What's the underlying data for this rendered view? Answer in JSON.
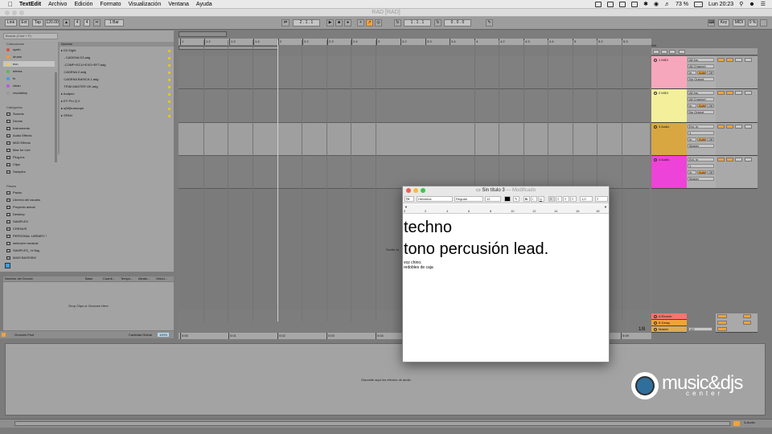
{
  "menubar": {
    "app": "TextEdit",
    "items": [
      "Archivo",
      "Edición",
      "Formato",
      "Visualización",
      "Ventana",
      "Ayuda"
    ],
    "battery": "73 %",
    "clock": "Lun 20:23"
  },
  "live_window": {
    "title": "RAD [RAD]"
  },
  "transport": {
    "link": "Link",
    "ext": "Ext",
    "tap": "Tap",
    "tempo": "120.00",
    "signature_num": "4",
    "signature_den": "4",
    "quantize": "1 Bar",
    "position": "2 . 1 . 1",
    "loop_start": "1 . 1 . 1",
    "loop_length": "0 . 0 . 0",
    "key": "Key",
    "midi": "MIDI",
    "cpu": "0 %"
  },
  "browser": {
    "search_placeholder": "Buscar (Cmd + F)",
    "collections_header": "Colecciones",
    "collections": [
      {
        "label": "synth",
        "color": "#e24b3b"
      },
      {
        "label": "drums",
        "color": "#f29a32"
      },
      {
        "label": "ecu",
        "color": "#e5d142"
      },
      {
        "label": "eterea",
        "color": "#4dbf4a"
      },
      {
        "label": "fx",
        "color": "#3aa0e0"
      },
      {
        "label": "clean",
        "color": "#b55ad9"
      },
      {
        "label": "revdubtep",
        "color": "#9a9a9a"
      }
    ],
    "categories_header": "Categorías",
    "categories": [
      "Sounds",
      "Drums",
      "Instruments",
      "Audio Effects",
      "MIDI Effects",
      "Max for Live",
      "Plug-ins",
      "Clips",
      "Samples"
    ],
    "places_header": "Places",
    "places": [
      "Packs",
      "Librería del usuario",
      "Proyecto actual",
      "Desktop",
      "SAMPLES",
      "CREMUS",
      "PERSONAL LIBRARY !",
      "selección musical",
      "SAMPLES_ hi flag",
      "MAIS BASSISM"
    ],
    "files_header": "Nombre",
    "files": [
      "D2 Eight",
      "- CADENA D3.adg",
      "-COMP+ECU+EXO+EFT.adg",
      "CADENA 2.adg",
      "CADENA BASICA 1.adg",
      "TRIM MASTER OK.adg",
      "Audpec",
      "EY Pro Q 2",
      "s(M)busscope",
      "SPAN"
    ]
  },
  "drum_pool": {
    "columns": [
      "Nombre del Groove",
      "Base",
      "Cuanti...",
      "Tempo...",
      "Aleato...",
      "Veloci..."
    ],
    "drop_text": "Drop Clips or Grooves Here",
    "footer_left": "Grooves Pool",
    "footer_label": "Cantidad Global",
    "footer_value": "100%"
  },
  "arrangement": {
    "ruler_top": [
      "1",
      "1.2",
      "1.3",
      "1.4",
      "2",
      "2.2",
      "2.3",
      "2.4",
      "3",
      "3.2",
      "3.3",
      "3.4",
      "4",
      "4.2",
      "4.3",
      "4.4",
      "5",
      "5.2",
      "5.3"
    ],
    "ruler_bottom": [
      "0:00",
      "0:01",
      "0:02",
      "0:03",
      "0:04",
      "0:05",
      "0:06",
      "0:07",
      "0:08",
      "0:09"
    ],
    "drop_hint": "Suelte Ar",
    "zoom": "1/8"
  },
  "tracks": [
    {
      "name": "1 MIDI",
      "color": "#f7a7bb",
      "input": "All Ins",
      "channel": "All Channel",
      "monitor": "In",
      "auto": "Auto",
      "off": "Off",
      "output": "No Output"
    },
    {
      "name": "2 MIDI",
      "color": "#f4ef9a",
      "input": "All Ins",
      "channel": "All Channel",
      "monitor": "In",
      "auto": "Auto",
      "off": "Off",
      "output": "No Output"
    },
    {
      "name": "3 Audio",
      "color": "#d9a742",
      "input": "Ext. In",
      "channel": "1",
      "monitor": "In",
      "auto": "Auto",
      "off": "Off",
      "output": "Master"
    },
    {
      "name": "4 Audio",
      "color": "#ee43d8",
      "input": "Ext. In",
      "channel": "1",
      "monitor": "In",
      "auto": "Auto",
      "off": "Off",
      "output": "Master"
    }
  ],
  "returns": [
    {
      "name": "A Reverb",
      "color": "#f2776e"
    },
    {
      "name": "B Delay",
      "color": "#f2a23a"
    },
    {
      "name": "Master",
      "color": "#e0a950"
    }
  ],
  "master_output": "1/2",
  "mixer_set": "Set",
  "device_drop": "Deposite aquí los efectos de audio",
  "status_right": "3-Audio",
  "logo": {
    "main": "music&djs",
    "sub": "center"
  },
  "textedit": {
    "title": "Sin título 3",
    "modified": "— Modificado",
    "font": "Helvetica",
    "style": "Regular",
    "size": "12",
    "spacing": "1,0",
    "list": "≡",
    "ruler": [
      "0",
      "2",
      "4",
      "6",
      "8",
      "10",
      "12",
      "14",
      "16",
      "18"
    ],
    "big_lines": [
      "techno",
      "tono percusión lead."
    ],
    "small_lines": [
      "voz chino.",
      "redobles de caja"
    ]
  }
}
